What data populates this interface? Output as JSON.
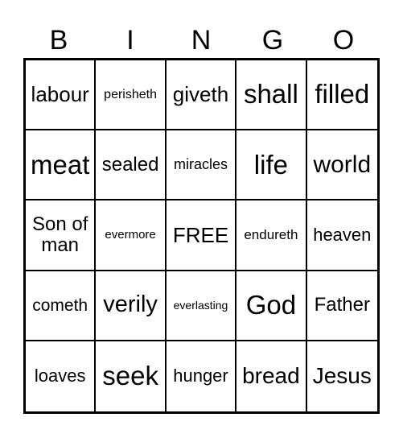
{
  "header": [
    "B",
    "I",
    "N",
    "G",
    "O"
  ],
  "cells": [
    {
      "text": "labour",
      "size": 26
    },
    {
      "text": "perisheth",
      "size": 16
    },
    {
      "text": "giveth",
      "size": 26
    },
    {
      "text": "shall",
      "size": 33
    },
    {
      "text": "filled",
      "size": 33
    },
    {
      "text": "meat",
      "size": 33
    },
    {
      "text": "sealed",
      "size": 24
    },
    {
      "text": "miracles",
      "size": 18
    },
    {
      "text": "life",
      "size": 33
    },
    {
      "text": "world",
      "size": 30
    },
    {
      "text": "Son of man",
      "size": 24
    },
    {
      "text": "evermore",
      "size": 15
    },
    {
      "text": "FREE",
      "size": 26
    },
    {
      "text": "endureth",
      "size": 17
    },
    {
      "text": "heaven",
      "size": 22
    },
    {
      "text": "cometh",
      "size": 21
    },
    {
      "text": "verily",
      "size": 29
    },
    {
      "text": "everlasting",
      "size": 14
    },
    {
      "text": "God",
      "size": 33
    },
    {
      "text": "Father",
      "size": 24
    },
    {
      "text": "loaves",
      "size": 22
    },
    {
      "text": "seek",
      "size": 33
    },
    {
      "text": "hunger",
      "size": 22
    },
    {
      "text": "bread",
      "size": 28
    },
    {
      "text": "Jesus",
      "size": 28
    }
  ]
}
